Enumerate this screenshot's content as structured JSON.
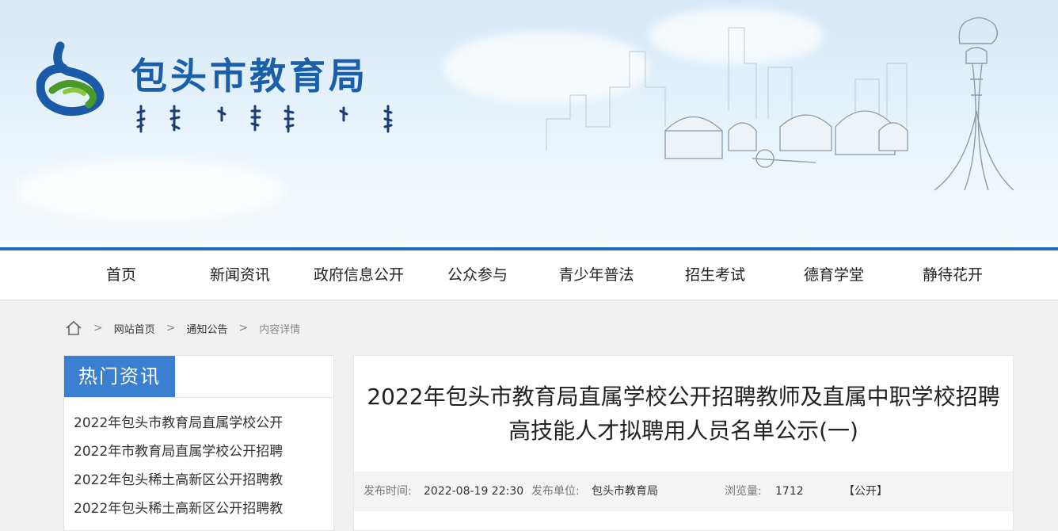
{
  "header": {
    "site_title": "包头市教育局",
    "mongolian_title": "ᠪᠤᠭᠤᠲᠤ ᠬᠣᠲᠠ ᠶᠢᠨ ᠪᠣᠯᠪᠠᠰᠤᠷᠠᠯ ᠤᠨ ᠲᠣᠪᠴᠢᠶ᠎ᠠ",
    "accent_color": "#1f6cc0"
  },
  "nav": {
    "items": [
      "首页",
      "新闻资讯",
      "政府信息公开",
      "公众参与",
      "青少年普法",
      "招生考试",
      "德育学堂",
      "静待花开"
    ]
  },
  "breadcrumb": {
    "home_icon": "home-icon",
    "separator": ">",
    "items": [
      "网站首页",
      "通知公告",
      "内容详情"
    ]
  },
  "sidebar": {
    "title": "热门资讯",
    "items": [
      "2022年包头市教育局直属学校公开",
      "2022年市教育局直属学校公开招聘",
      "2022年包头稀土高新区公开招聘教",
      "2022年包头稀土高新区公开招聘教"
    ]
  },
  "article": {
    "title": "2022年包头市教育局直属学校公开招聘教师及直属中职学校招聘高技能人才拟聘用人员名单公示(一)",
    "publish_time_label": "发布时间:",
    "publish_time": "2022-08-19 22:30",
    "publisher_label": "发布单位:",
    "publisher": "包头市教育局",
    "views_label": "浏览量:",
    "views": "1712",
    "visibility": "【公开】"
  }
}
